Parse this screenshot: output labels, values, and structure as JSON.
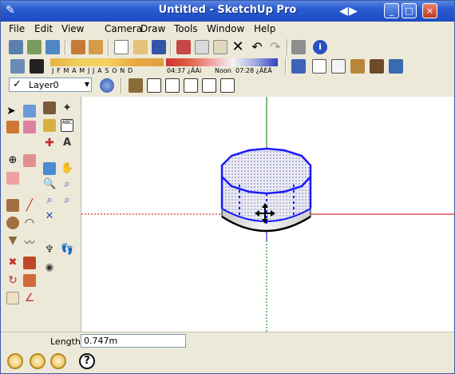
{
  "window": {
    "title": "Untitled - SketchUp Pro",
    "minimize": "_",
    "maximize": "□",
    "close": "×",
    "nav_back": "◀",
    "nav_forward": "▶"
  },
  "menu": [
    "File",
    "Edit",
    "View",
    "Camera",
    "Draw",
    "Tools",
    "Window",
    "Help"
  ],
  "shadows": {
    "months": "J F M A M J J A S O N D",
    "time_start": "04:37 ¿ÂÀi",
    "noon": "Noon",
    "time_end": "07:28 ¿ÂÈÄ"
  },
  "layer": {
    "current": "Layer0"
  },
  "status": {
    "label": "Length",
    "value": "0.747m"
  },
  "colors": {
    "accent": "#2a5bd0",
    "x_axis": "#cc0000",
    "y_axis": "#007a00",
    "z_axis": "#0000cc",
    "selection": "#1b1bff"
  },
  "icons": {
    "help": "?"
  }
}
